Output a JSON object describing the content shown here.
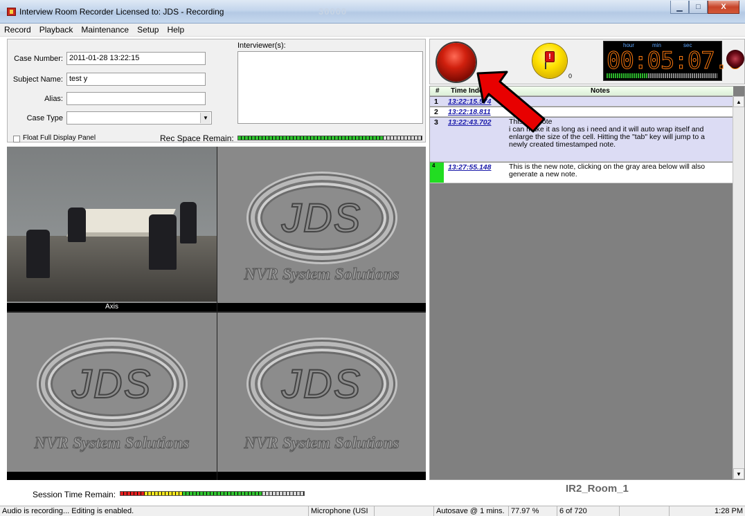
{
  "window": {
    "title": "Interview Room Recorder Licensed to: JDS - Recording",
    "ghost_text": "30000",
    "min_glyph": "▁",
    "max_glyph": "□",
    "close_glyph": "X"
  },
  "menu": [
    "Record",
    "Playback",
    "Maintenance",
    "Setup",
    "Help"
  ],
  "form": {
    "case_number_label": "Case Number:",
    "case_number_value": "2011-01-28 13:22:15",
    "subject_name_label": "Subject Name:",
    "subject_name_value": "test y",
    "alias_label": "Alias:",
    "alias_value": "",
    "case_type_label": "Case Type",
    "case_type_value": "",
    "interviewers_label": "Interviewer(s):",
    "float_panel_label": "Float Full Display Panel",
    "rec_space_label": "Rec Space Remain:",
    "rec_space_fraction": 0.79
  },
  "video": {
    "camera1_label": "Axis",
    "logo_text": "JDS",
    "logo_tagline": "NVR System Solutions"
  },
  "controls": {
    "flag_glyph": "!",
    "flag_count": "0",
    "clock_hour_label": "hour",
    "clock_min_label": "min",
    "clock_sec_label": "sec",
    "clock_value": "00:05:07.6"
  },
  "notes": {
    "headers": {
      "num": "#",
      "time": "Time Index",
      "notes": "Notes"
    },
    "rows": [
      {
        "num": "1",
        "time": "13:22:15.574",
        "text": ""
      },
      {
        "num": "2",
        "time": "13:22:18.811",
        "text": ""
      },
      {
        "num": "3",
        "time": "13:22:43.702",
        "text": "This is a note\ni can make it as long as i need and it will auto wrap itself and enlarge the size of the cell.  Hitting the \"tab\" key will jump to a newly created timestamped note."
      },
      {
        "num": "4",
        "time": "13:27:55.148",
        "text": "This is the new note, clicking on the gray area below will also generate a new note."
      }
    ]
  },
  "room_label": "IR2_Room_1",
  "session_label": "Session Time Remain:",
  "session_fraction": 0.78,
  "status": {
    "message": "Audio is recording... Editing is enabled.",
    "microphone": "Microphone (USI",
    "blank1": "",
    "autosave": "Autosave @ 1 mins.",
    "percent": "77.97 %",
    "count": "6 of 720",
    "blank2": "",
    "time": "1:28 PM"
  },
  "icons": {
    "record": "record-button-icon",
    "flag": "flag-marker-icon",
    "arrow": "red-pointer-arrow"
  }
}
